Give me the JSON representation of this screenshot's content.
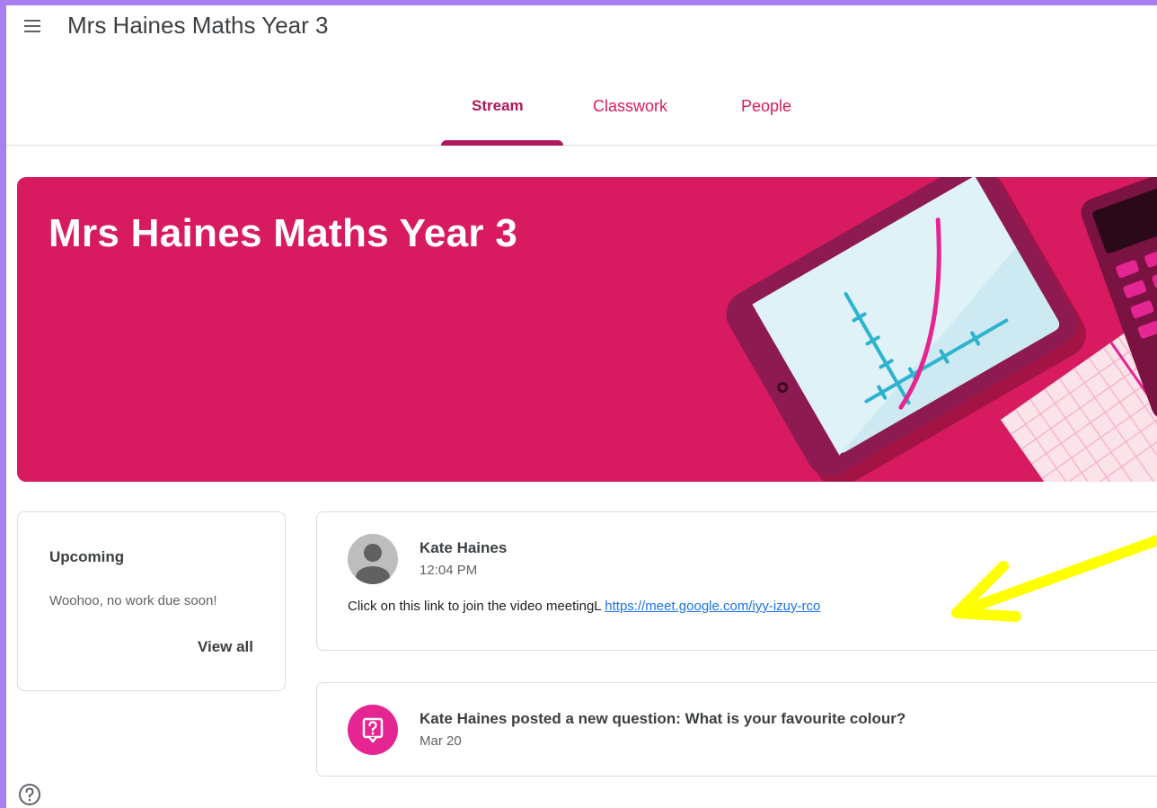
{
  "header": {
    "title": "Mrs Haines Maths Year 3",
    "menu_icon": "hamburger-menu-icon"
  },
  "tabs": [
    {
      "label": "Stream",
      "active": true
    },
    {
      "label": "Classwork",
      "active": false
    },
    {
      "label": "People",
      "active": false
    }
  ],
  "banner": {
    "title": "Mrs Haines Maths Year 3",
    "color": "#d81b60"
  },
  "upcoming": {
    "title": "Upcoming",
    "text": "Woohoo, no work due soon!",
    "view_all": "View all"
  },
  "posts": [
    {
      "author": "Kate Haines",
      "time": "12:04 PM",
      "body": "Click on this link to join the video meetingL ",
      "link": "https://meet.google.com/iyy-izuy-rco"
    }
  ],
  "question": {
    "title": "Kate Haines posted a new question: What is your favourite colour?",
    "date": "Mar 20",
    "icon": "question-icon"
  },
  "colors": {
    "accent": "#d81b60",
    "tab_active": "#b0165a",
    "link": "#1a73e8",
    "annotation_arrow": "#ffff00",
    "outer_frame": "#a97ff0"
  }
}
